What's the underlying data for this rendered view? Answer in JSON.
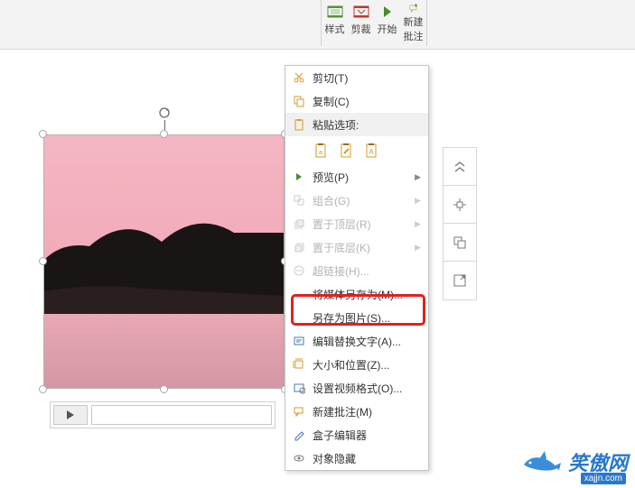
{
  "ribbon": {
    "style": "样式",
    "crop": "剪裁",
    "start": "开始",
    "new_comment_l1": "新建",
    "new_comment_l2": "批注"
  },
  "context_menu": {
    "cut": "剪切(T)",
    "copy": "复制(C)",
    "paste_options": "粘贴选项:",
    "preview": "预览(P)",
    "group": "组合(G)",
    "bring_front": "置于顶层(R)",
    "send_back": "置于底层(K)",
    "hyperlink": "超链接(H)...",
    "save_media_as": "将媒体另存为(M)...",
    "save_as_picture": "另存为图片(S)...",
    "edit_alt_text": "编辑替换文字(A)...",
    "size_position": "大小和位置(Z)...",
    "set_video_format": "设置视频格式(O)...",
    "new_comment": "新建批注(M)",
    "box_editor": "盒子编辑器",
    "object_hide": "对象隐藏"
  },
  "watermark": {
    "text": "笑傲网",
    "url": "xajjn.com"
  }
}
